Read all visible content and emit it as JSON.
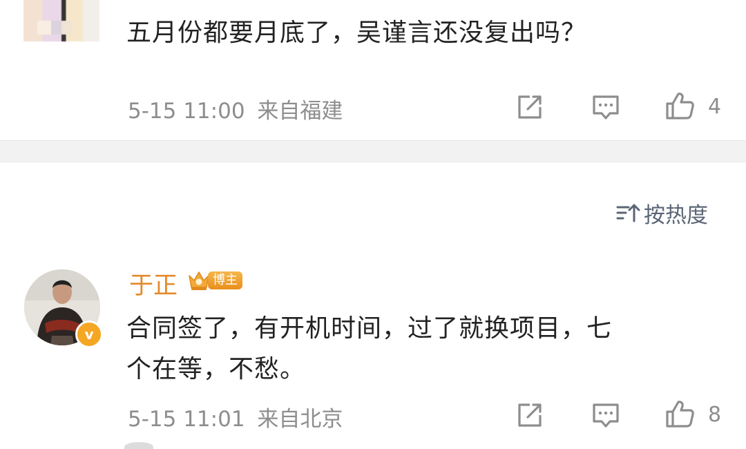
{
  "comments": [
    {
      "text_lines": [
        "五月份都要月底了，吴谨言还没复出吗？"
      ],
      "time": "5-15 11:00",
      "location": "来自福建",
      "likes": "4",
      "avatar": "blurred-avatar"
    },
    {
      "username": "于正",
      "badge": "博主",
      "verified_mark": "v",
      "text_lines": [
        "合同签了，有开机时间，过了就换项目，七",
        "个在等，不愁。"
      ],
      "time": "5-15 11:01",
      "location": "来自北京",
      "likes": "8",
      "avatar": "user-avatar"
    }
  ],
  "sort": {
    "label": "按热度",
    "icon": "sort-icon"
  },
  "icons": [
    "share-icon",
    "comment-icon",
    "like-icon"
  ],
  "colors": {
    "text": "#222222",
    "meta": "#8d8d8d",
    "username": "#e4892b",
    "badge": "#f0a030",
    "divider": "#f2f2f2",
    "sort": "#5a6575"
  }
}
